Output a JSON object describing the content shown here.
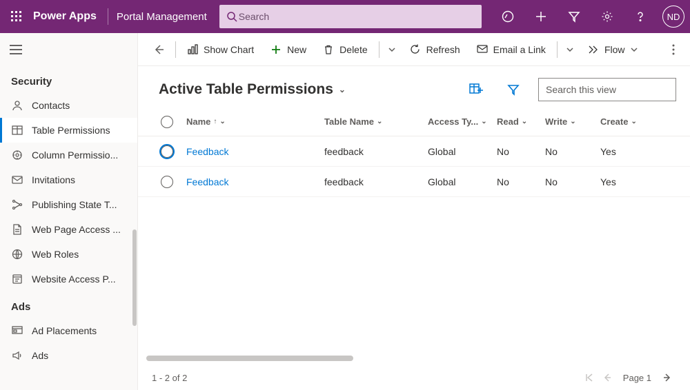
{
  "topbar": {
    "brand": "Power Apps",
    "app_title": "Portal Management",
    "search_placeholder": "Search",
    "avatar_initials": "ND"
  },
  "sidebar": {
    "groups": [
      {
        "title": "Security",
        "items": [
          {
            "label": "Contacts",
            "icon": "contact"
          },
          {
            "label": "Table Permissions",
            "icon": "table",
            "selected": true
          },
          {
            "label": "Column Permissio...",
            "icon": "column"
          },
          {
            "label": "Invitations",
            "icon": "invitation"
          },
          {
            "label": "Publishing State T...",
            "icon": "publish"
          },
          {
            "label": "Web Page Access ...",
            "icon": "page"
          },
          {
            "label": "Web Roles",
            "icon": "roles"
          },
          {
            "label": "Website Access P...",
            "icon": "access"
          }
        ]
      },
      {
        "title": "Ads",
        "items": [
          {
            "label": "Ad Placements",
            "icon": "placements"
          },
          {
            "label": "Ads",
            "icon": "ads"
          }
        ]
      }
    ]
  },
  "commandbar": {
    "show_chart": "Show Chart",
    "new": "New",
    "delete": "Delete",
    "refresh": "Refresh",
    "email_link": "Email a Link",
    "flow": "Flow"
  },
  "view": {
    "title": "Active Table Permissions",
    "quickfind_placeholder": "Search this view"
  },
  "grid": {
    "columns": {
      "name": "Name",
      "table_name": "Table Name",
      "access_type": "Access Ty...",
      "read": "Read",
      "write": "Write",
      "create": "Create"
    },
    "rows": [
      {
        "name": "Feedback",
        "table_name": "feedback",
        "access_type": "Global",
        "read": "No",
        "write": "No",
        "create": "Yes",
        "selected": true
      },
      {
        "name": "Feedback",
        "table_name": "feedback",
        "access_type": "Global",
        "read": "No",
        "write": "No",
        "create": "Yes",
        "selected": false
      }
    ]
  },
  "footer": {
    "summary": "1 - 2 of 2",
    "page_label": "Page 1"
  }
}
